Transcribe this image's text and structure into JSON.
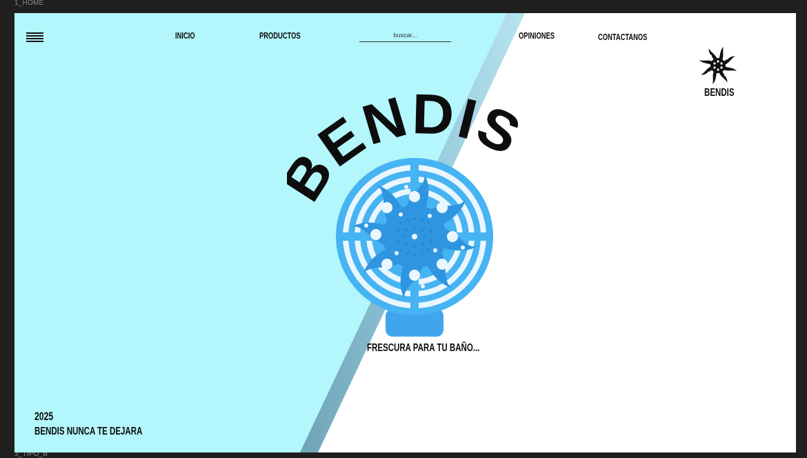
{
  "canvas": {
    "frame_label_top": "1_HOME",
    "frame_label_bottom": "3_TIPO_B"
  },
  "nav": {
    "menu_icon": "hamburger-menu-icon",
    "items": [
      {
        "label": "INICIO"
      },
      {
        "label": "PRODUCTOS"
      },
      {
        "label": "OPINIONES"
      },
      {
        "label": "CONTACTANOS"
      }
    ]
  },
  "search": {
    "placeholder": "buscar..."
  },
  "brand": {
    "logo_icon": "sun-swirl-logo-icon",
    "name": "BENDIS"
  },
  "hero": {
    "title": "BENDIS",
    "product_image": "urinal-screen-product",
    "tagline": "FRESCURA PARA TU BAÑO..."
  },
  "footer": {
    "year": "2025",
    "slogan": "BENDIS NUNCA TE DEJARA"
  },
  "colors": {
    "background_cyan": "#b3f6fb",
    "stripe_blue": "#6fa9bf",
    "product_blue": "#3aa8ef",
    "text_dark": "#0d0d0d"
  }
}
